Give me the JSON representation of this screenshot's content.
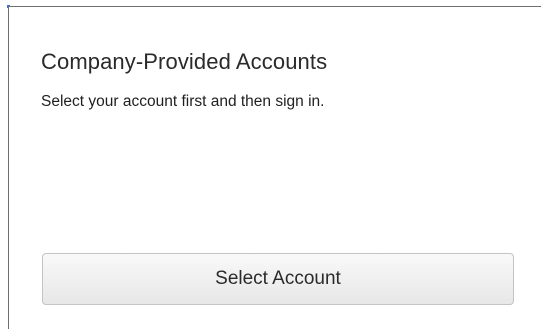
{
  "panel": {
    "title": "Company-Provided Accounts",
    "subtitle": "Select your account first and then sign in.",
    "select_button_label": "Select Account"
  },
  "colors": {
    "border": "#6f6f6f",
    "accent": "#3a6fd8",
    "button_top": "#f9f9f9",
    "button_bottom": "#e7e7e7"
  }
}
